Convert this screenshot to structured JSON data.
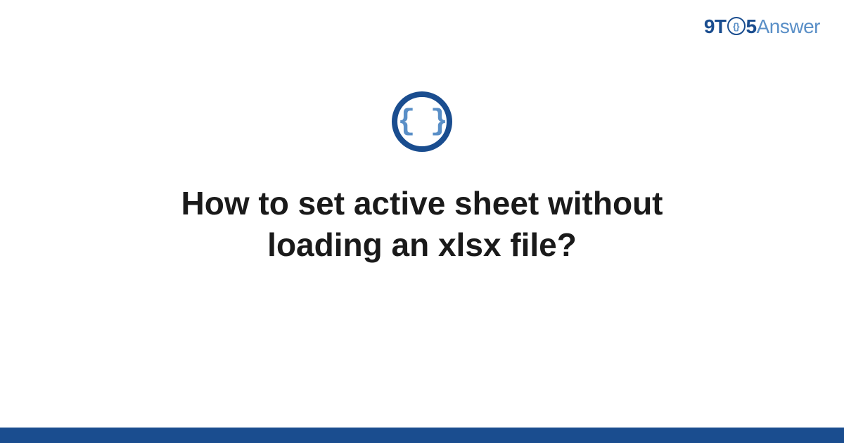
{
  "logo": {
    "part1": "9T",
    "clock_inner": "{}",
    "part2": "5",
    "part3": "Answer"
  },
  "icon": {
    "braces": "{ }"
  },
  "question": {
    "title": "How to set active sheet without loading an xlsx file?"
  },
  "colors": {
    "primary_dark": "#1a4d8f",
    "primary_light": "#5a8fc7",
    "text": "#1a1a1a",
    "background": "#ffffff"
  }
}
